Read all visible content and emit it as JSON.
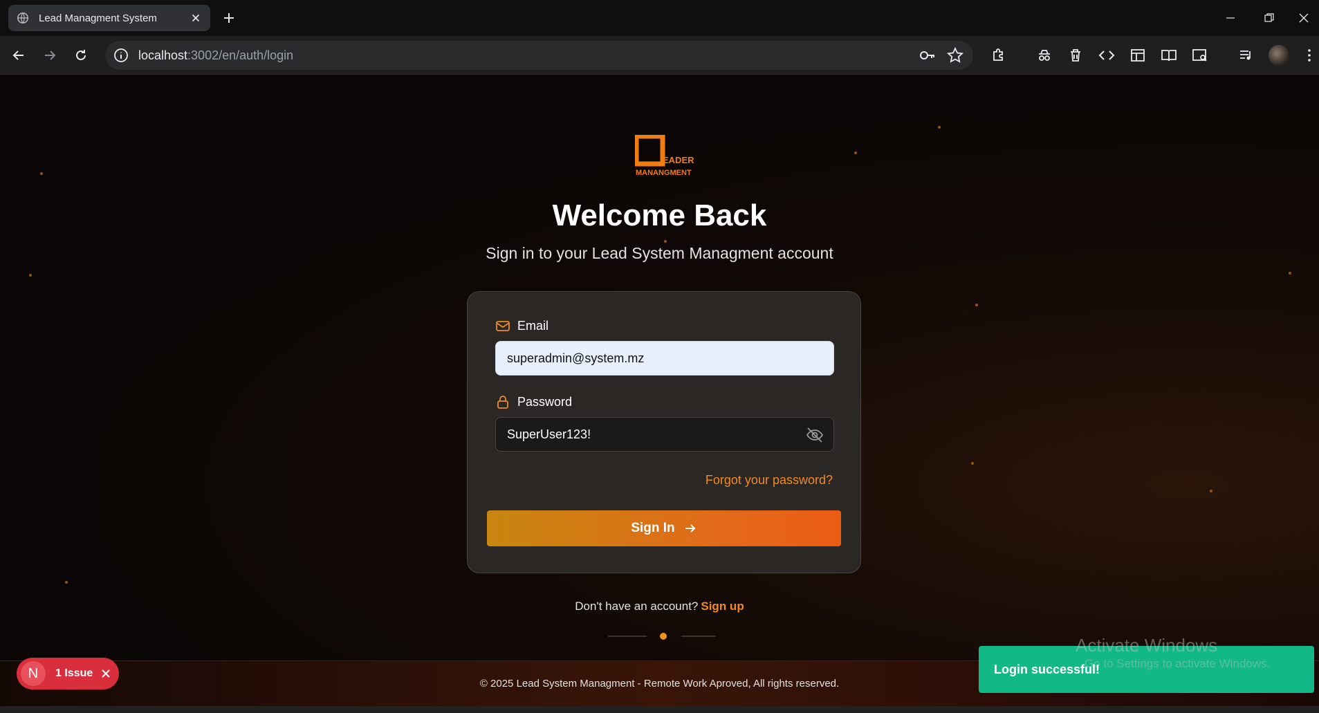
{
  "browser": {
    "tab_title": "Lead Managment System",
    "url_host": "localhost",
    "url_rest": ":3002/en/auth/login"
  },
  "page": {
    "logo_text_top": "EADER",
    "logo_text_bottom": "MANANGMENT",
    "title": "Welcome Back",
    "subtitle": "Sign in to your Lead System Managment account",
    "form": {
      "email_label": "Email",
      "email_value": "superadmin@system.mz",
      "password_label": "Password",
      "password_value": "SuperUser123!",
      "forgot_link": "Forgot your password?",
      "submit_label": "Sign In"
    },
    "signup_prompt": "Don't have an account?",
    "signup_link": "Sign up",
    "footer": "© 2025 Lead System Managment - Remote Work Aproved, All rights reserved."
  },
  "overlays": {
    "issues_badge_letter": "N",
    "issues_label": "1 Issue",
    "toast_message": "Login successful!",
    "watermark_title": "Activate Windows",
    "watermark_subtitle": "Go to Settings to activate Windows."
  },
  "colors": {
    "accent": "#f08a24",
    "button_start": "#c7860f",
    "button_end": "#ea5c12",
    "toast_bg": "#12b886",
    "issue_bg": "#d92e3c"
  }
}
